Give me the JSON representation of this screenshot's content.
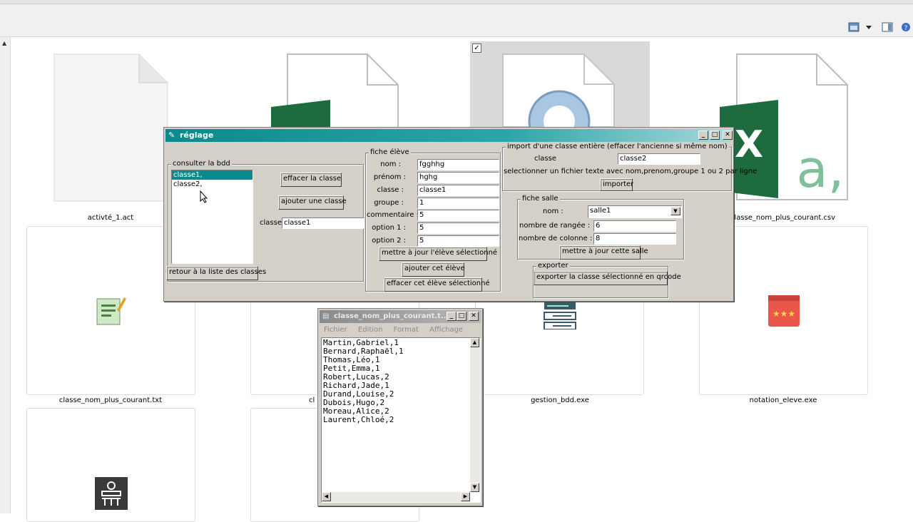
{
  "explorer": {
    "files": {
      "activite": "activté_1.act",
      "csv": "classe_nom_plus_courant.csv",
      "txt": "classe_nom_plus_courant.txt",
      "partial": "cl",
      "gestion": "gestion_bdd.exe",
      "notation": "notation_eleve.exe"
    },
    "checkbox_mark": "✓"
  },
  "reglage": {
    "title": "réglage",
    "consulter": {
      "legend": "consulter la bdd",
      "classes": [
        "classe1,",
        "classe2,"
      ],
      "selected_index": 0,
      "effacer_btn": "effacer la classe",
      "ajouter_btn": "ajouter une classe",
      "classe_label": "classe",
      "classe_value": "classe1",
      "retour_btn": "retour à la liste des classes"
    },
    "fiche_eleve": {
      "legend": "fiche élève",
      "nom_label": "nom :",
      "nom_value": "fgghhg",
      "prenom_label": "prénom :",
      "prenom_value": "hghg",
      "classe_label": "classe :",
      "classe_value": "classe1",
      "groupe_label": "groupe :",
      "groupe_value": "1",
      "commentaire_label": "commentaire :",
      "commentaire_value": "5",
      "option1_label": "option 1 :",
      "option1_value": "5",
      "option2_label": "option 2 :",
      "option2_value": "5",
      "maj_btn": "mettre à jour l'élève sélectionné",
      "ajouter_btn": "ajouter cet élève",
      "effacer_btn": "effacer cet élève sélectionné"
    },
    "import": {
      "legend": "import d'une classe entière (effacer l'ancienne si même nom)",
      "classe_label": "classe",
      "classe_value": "classe2",
      "hint": "selectionner un fichier texte avec nom,prenom,groupe 1 ou 2 par ligne",
      "importer_btn": "importer"
    },
    "fiche_salle": {
      "legend": "fiche salle",
      "nom_label": "nom :",
      "nom_value": "salle1",
      "rangees_label": "nombre de rangée :",
      "rangees_value": "6",
      "colonnes_label": "nombre de colonne :",
      "colonnes_value": "8",
      "maj_btn": "mettre à jour cette salle"
    },
    "exporter": {
      "legend": "exporter",
      "btn": "exporter la classe sélectionné en qrcode"
    }
  },
  "notepad": {
    "title": "classe_nom_plus_courant.t...",
    "menu": [
      "Fichier",
      "Edition",
      "Format",
      "Affichage",
      "?"
    ],
    "content": "Martin,Gabriel,1\nBernard,Raphaël,1\nThomas,Léo,1\nPetit,Emma,1\nRobert,Lucas,2\nRichard,Jade,1\nDurand,Louise,2\nDubois,Hugo,2\nMoreau,Alice,2\nLaurent,Chloé,2"
  }
}
